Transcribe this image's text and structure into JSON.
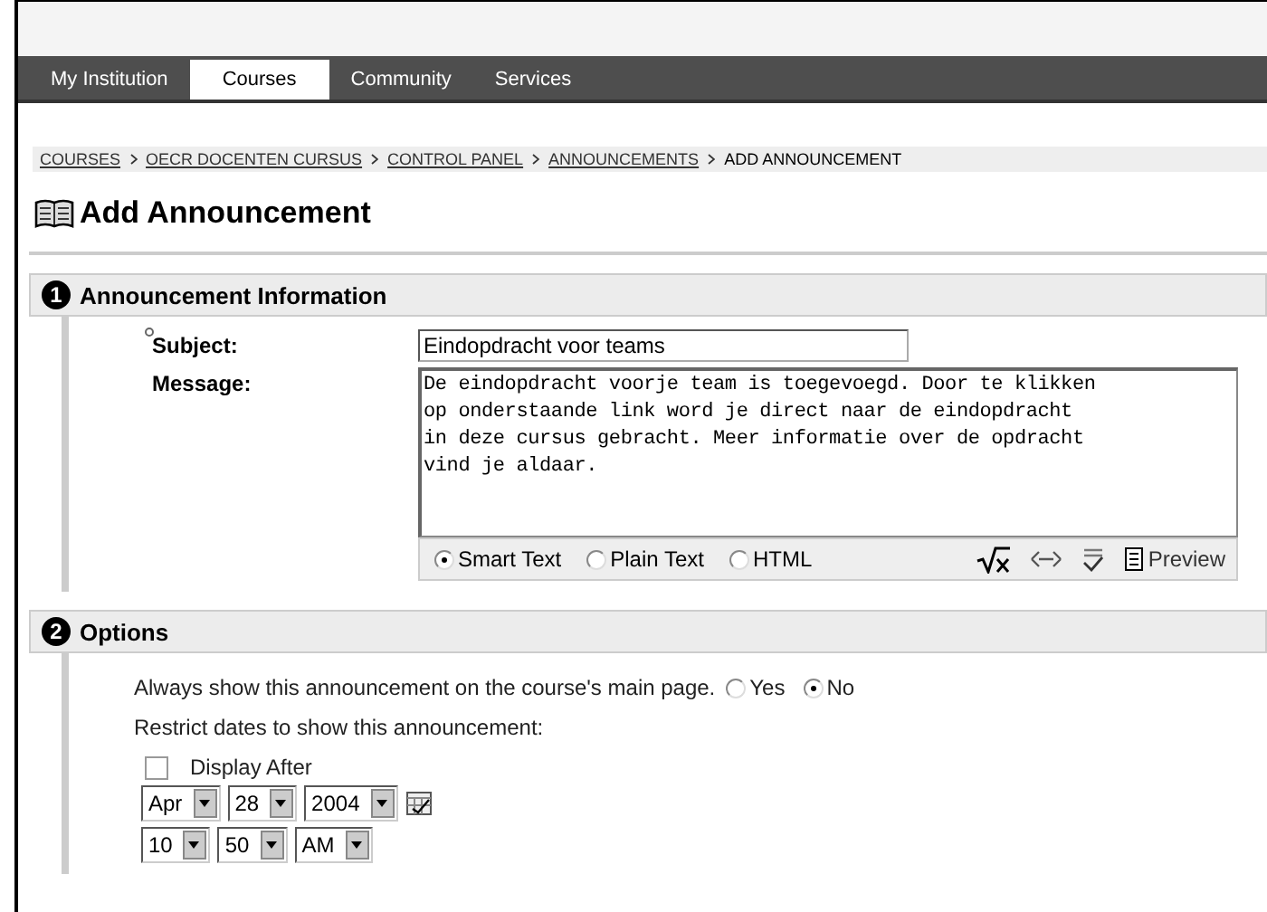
{
  "tabs": [
    {
      "label": "My Institution",
      "selected": false
    },
    {
      "label": "Courses",
      "selected": true
    },
    {
      "label": "Community",
      "selected": false
    },
    {
      "label": "Services",
      "selected": false
    }
  ],
  "breadcrumb": [
    {
      "label": "COURSES",
      "link": true
    },
    {
      "label": "OECR DOCENTEN CURSUS",
      "link": true
    },
    {
      "label": "CONTROL PANEL",
      "link": true
    },
    {
      "label": "ANNOUNCEMENTS",
      "link": true
    },
    {
      "label": "ADD ANNOUNCEMENT",
      "link": false
    }
  ],
  "page_title": "Add Announcement",
  "sections": [
    {
      "number": "1",
      "title": "Announcement Information",
      "kind": "info",
      "subject": {
        "label": "Subject:",
        "required": true,
        "value": "Eindopdracht voor teams"
      },
      "message": {
        "label": "Message:",
        "value": "De eindopdracht voorje team is toegevoegd. Door te klikken\nop onderstaande link word je direct naar de eindopdracht\nin deze cursus gebracht. Meer informatie over de opdracht\nvind je aldaar."
      },
      "formats": [
        {
          "label": "Smart Text",
          "selected": true
        },
        {
          "label": "Plain Text",
          "selected": false
        },
        {
          "label": "HTML",
          "selected": false
        }
      ],
      "preview": "Preview"
    },
    {
      "number": "2",
      "title": "Options",
      "kind": "options",
      "always_show": {
        "label": "Always show this announcement on the course's main page.",
        "choices": [
          {
            "label": "Yes",
            "selected": false
          },
          {
            "label": "No",
            "selected": true
          }
        ]
      },
      "restrict_label": "Restrict dates to show this announcement:",
      "display_after": {
        "label": "Display After",
        "checked": false
      },
      "date": [
        "Apr",
        "28",
        "2004"
      ],
      "time": [
        "10",
        "50",
        "AM"
      ]
    }
  ]
}
